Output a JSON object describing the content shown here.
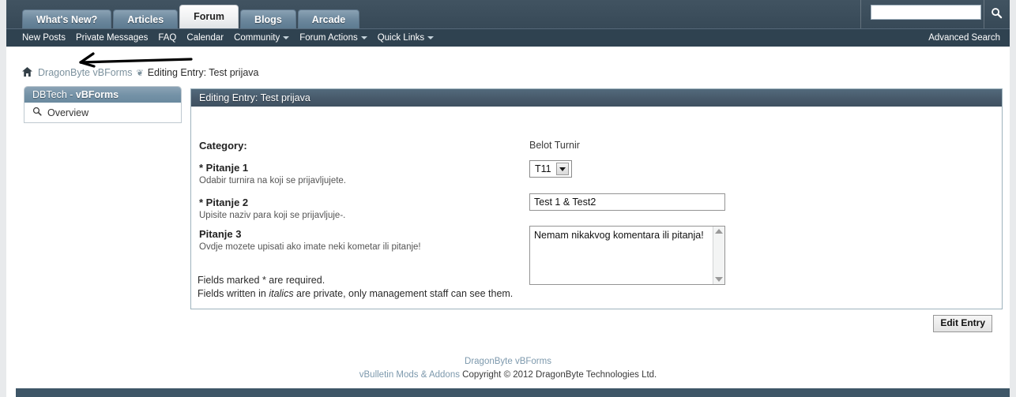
{
  "nav": {
    "tabs": [
      {
        "label": "What's New?",
        "active": false
      },
      {
        "label": "Articles",
        "active": false
      },
      {
        "label": "Forum",
        "active": true
      },
      {
        "label": "Blogs",
        "active": false
      },
      {
        "label": "Arcade",
        "active": false
      }
    ],
    "links": [
      {
        "label": "New Posts",
        "caret": false
      },
      {
        "label": "Private Messages",
        "caret": false
      },
      {
        "label": "FAQ",
        "caret": false
      },
      {
        "label": "Calendar",
        "caret": false
      },
      {
        "label": "Community",
        "caret": true
      },
      {
        "label": "Forum Actions",
        "caret": true
      },
      {
        "label": "Quick Links",
        "caret": true
      }
    ],
    "advanced_search": "Advanced Search",
    "search": {
      "value": "",
      "placeholder": "",
      "icon": "search-icon"
    }
  },
  "breadcrumb": {
    "home_icon": "home-icon",
    "link": "DragonByte vBForms",
    "separator": "❦",
    "current": "Editing Entry: Test prijava"
  },
  "annotation": {
    "type": "hand-drawn-arrow",
    "direction": "left",
    "color": "#000000"
  },
  "sidebar": {
    "title_prefix": "DBTech",
    "title_sep": " - ",
    "title_suffix": "vBForms",
    "items": [
      {
        "label": "Overview",
        "icon": "magnifier-icon"
      }
    ]
  },
  "panel": {
    "title": "Editing Entry: Test prijava",
    "fields": [
      {
        "label": "Category:",
        "desc": "",
        "value": "Belot Turnir",
        "control": "text"
      },
      {
        "label": "* Pitanje 1",
        "desc": "Odabir turnira na koji se prijavljujete.",
        "value": "T11",
        "control": "select"
      },
      {
        "label": "* Pitanje 2",
        "desc": "Upisite naziv para koji se prijavljuje-.",
        "value": "Test 1 & Test2",
        "control": "input"
      },
      {
        "label": "Pitanje 3",
        "desc": "Ovdje mozete upisati ako imate neki kometar ili pitanje!",
        "value": "Nemam nikakvog komentara ili pitanja!",
        "control": "textarea"
      }
    ],
    "notes": {
      "line1": "Fields marked * are required.",
      "line2_a": "Fields written in ",
      "line2_italic": "italics",
      "line2_b": " are private, only management staff can see them."
    }
  },
  "actions": {
    "edit_entry": "Edit Entry"
  },
  "footer": {
    "product_link": "DragonByte vBForms",
    "mods_link": "vBulletin Mods & Addons",
    "copyright": " Copyright © 2012 DragonByte Technologies Ltd."
  },
  "colors": {
    "navbar": "#3b4d5b",
    "navrow2": "#2f4250",
    "panel_header": "#47596a",
    "sidebar_header": "#7391a6",
    "link": "#7d99ad",
    "footer_bar": "#3e5667"
  }
}
